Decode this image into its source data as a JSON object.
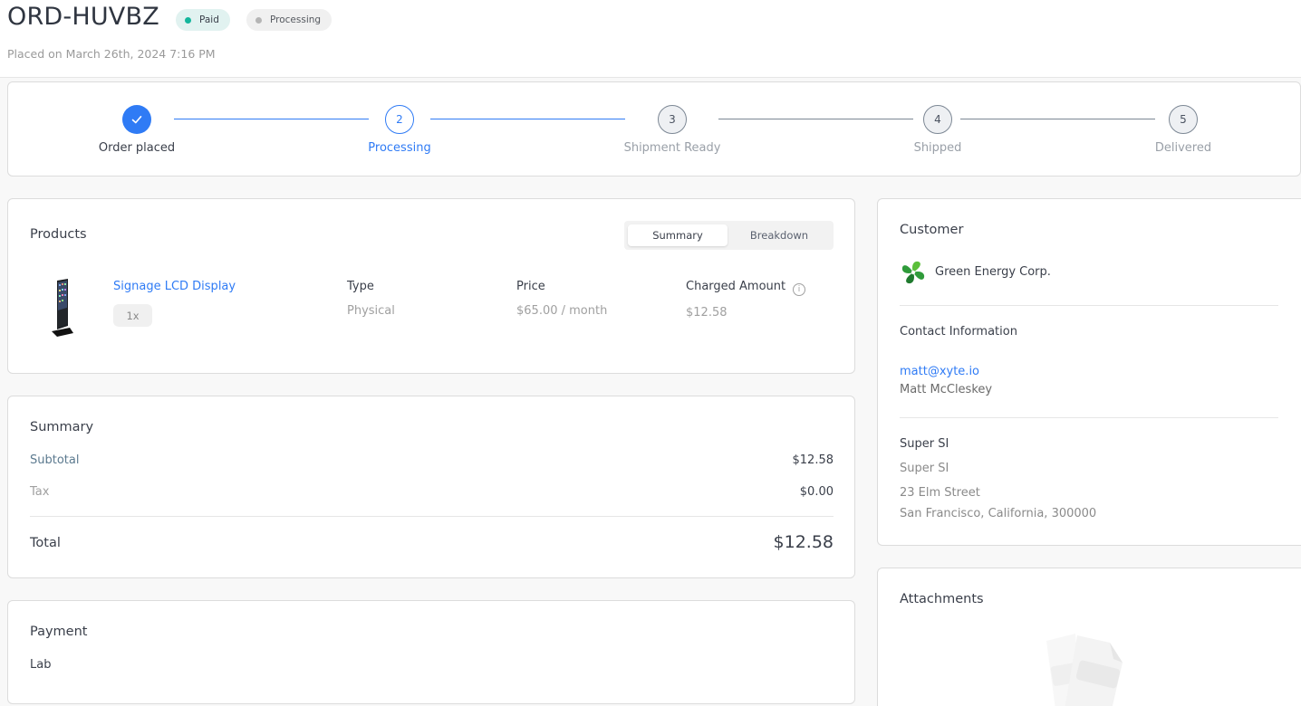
{
  "header": {
    "order_id": "ORD-HUVBZ",
    "badges": [
      {
        "label": "Paid",
        "color": "#13b69c"
      },
      {
        "label": "Processing",
        "color": "#b5b5b5"
      }
    ],
    "placed_on": "Placed on March 26th, 2024 7:16 PM"
  },
  "stepper": {
    "accent": "#2f7bf5",
    "steps": [
      {
        "number": "1",
        "label": "Order placed",
        "state": "done"
      },
      {
        "number": "2",
        "label": "Processing",
        "state": "active"
      },
      {
        "number": "3",
        "label": "Shipment Ready",
        "state": "pending"
      },
      {
        "number": "4",
        "label": "Shipped",
        "state": "pending"
      },
      {
        "number": "5",
        "label": "Delivered",
        "state": "pending"
      }
    ]
  },
  "products": {
    "title": "Products",
    "view_toggle": {
      "options": [
        "Summary",
        "Breakdown"
      ],
      "selected": "Summary"
    },
    "columns": {
      "type": "Type",
      "price": "Price",
      "charged": "Charged Amount"
    },
    "items": [
      {
        "name": "Signage LCD Display",
        "quantity": "1x",
        "type": "Physical",
        "price": "$65.00 / month",
        "charged_amount": "$12.58"
      }
    ]
  },
  "summary": {
    "title": "Summary",
    "subtotal_label": "Subtotal",
    "subtotal_value": "$12.58",
    "tax_label": "Tax",
    "tax_value": "$0.00",
    "total_label": "Total",
    "total_value": "$12.58"
  },
  "payment": {
    "title": "Payment",
    "method": "Lab"
  },
  "customer": {
    "title": "Customer",
    "company": "Green Energy Corp.",
    "contact_title": "Contact Information",
    "email": "matt@xyte.io",
    "contact_name": "Matt McCleskey",
    "address_title": "Super SI",
    "address_name": "Super SI",
    "street": "23 Elm Street",
    "city_line": "San Francisco, California, 300000"
  },
  "attachments": {
    "title": "Attachments"
  }
}
